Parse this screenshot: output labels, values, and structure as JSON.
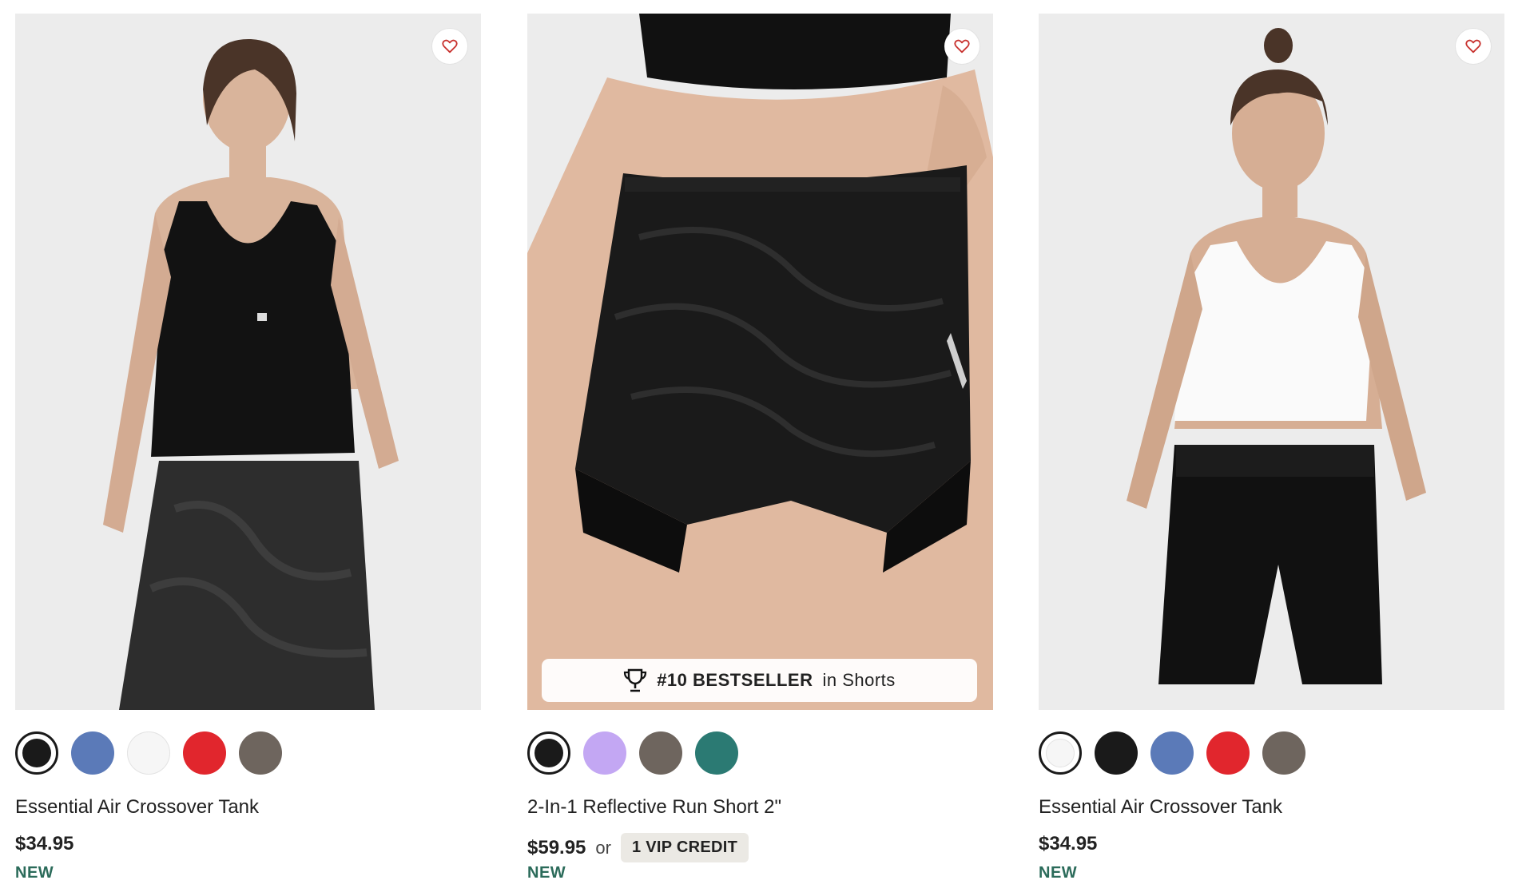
{
  "products": [
    {
      "name": "Essential Air Crossover Tank",
      "price": "$34.95",
      "tag": "NEW",
      "swatches": [
        "#1a1a1a",
        "#5b7ab8",
        "#f6f6f6",
        "#e1262d",
        "#6e655e"
      ],
      "selected_swatch": 0,
      "favorite_icon": "heart-outline-icon"
    },
    {
      "name": "2-In-1 Reflective Run Short 2\"",
      "price": "$59.95",
      "price_or": "or",
      "vip_credit": "1 VIP CREDIT",
      "tag": "NEW",
      "bestseller_rank": "#10 BESTSELLER",
      "bestseller_suffix": "in Shorts",
      "swatches": [
        "#1a1a1a",
        "#c3a7f3",
        "#6e655e",
        "#2b7a73"
      ],
      "selected_swatch": 0,
      "favorite_icon": "heart-outline-icon"
    },
    {
      "name": "Essential Air Crossover Tank",
      "price": "$34.95",
      "tag": "NEW",
      "swatches": [
        "#f6f6f6",
        "#1a1a1a",
        "#5b7ab8",
        "#e1262d",
        "#6e655e"
      ],
      "selected_swatch": 0,
      "favorite_icon": "heart-outline-icon"
    }
  ],
  "colors": {
    "accent_new": "#2b6b5a",
    "favorite": "#c8322f"
  }
}
